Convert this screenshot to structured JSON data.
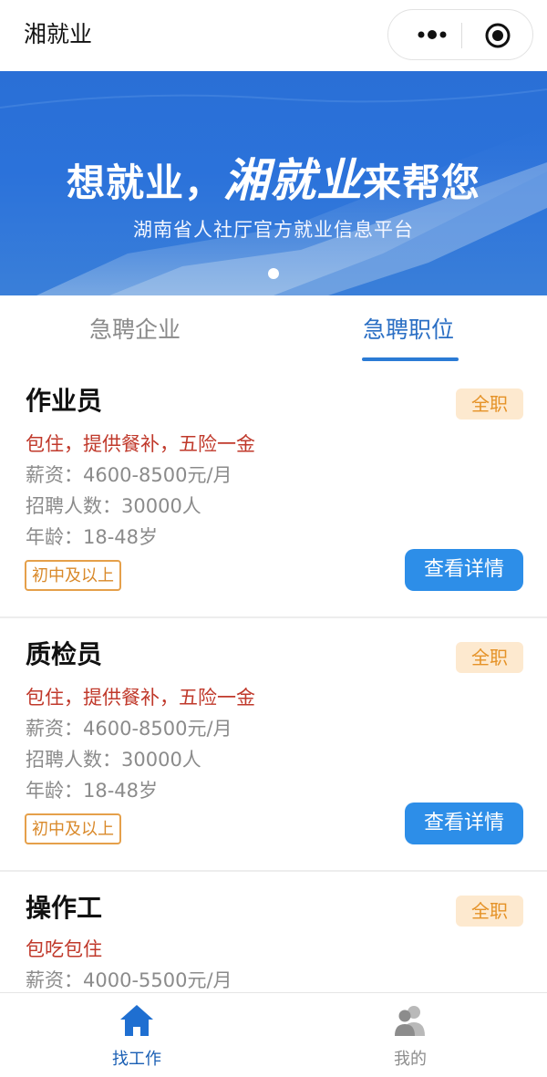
{
  "app": {
    "title": "湘就业"
  },
  "banner": {
    "headline_pre": "想就业，",
    "headline_brand": "湘就业",
    "headline_post": "来帮您",
    "subtitle": "湖南省人社厅官方就业信息平台"
  },
  "tabs": [
    {
      "label": "急聘企业",
      "active": false
    },
    {
      "label": "急聘职位",
      "active": true
    }
  ],
  "jobs": [
    {
      "title": "作业员",
      "type": "全职",
      "benefits": "包住，提供餐补，五险一金",
      "salary": "薪资：4600-8500元/月",
      "headcount": "招聘人数：30000人",
      "age": "年龄：18-48岁",
      "education": "初中及以上",
      "button": "查看详情"
    },
    {
      "title": "质检员",
      "type": "全职",
      "benefits": "包住，提供餐补，五险一金",
      "salary": "薪资：4600-8500元/月",
      "headcount": "招聘人数：30000人",
      "age": "年龄：18-48岁",
      "education": "初中及以上",
      "button": "查看详情"
    },
    {
      "title": "操作工",
      "type": "全职",
      "benefits": "包吃包住",
      "salary": "薪资：4000-5500元/月"
    }
  ],
  "tabbar": [
    {
      "label": "找工作",
      "icon": "home-icon",
      "active": true
    },
    {
      "label": "我的",
      "icon": "user-group-icon",
      "active": false
    }
  ],
  "colors": {
    "accent": "#2d8ee8",
    "tab_active": "#2b6fc4",
    "benefit_red": "#c0392b",
    "badge_orange": "#e59227",
    "badge_bg": "#fde9cf"
  }
}
